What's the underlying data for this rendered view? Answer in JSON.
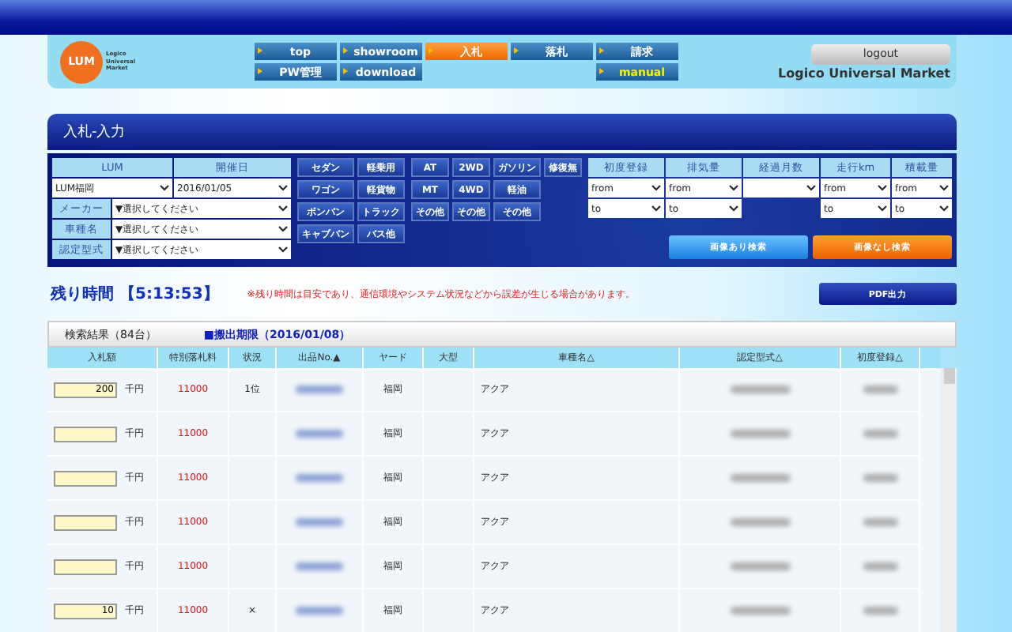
{
  "header": {
    "logo": {
      "mark": "LUM",
      "lines": [
        "Logico",
        "Universal",
        "Market"
      ]
    },
    "nav": [
      {
        "kind": "link",
        "label": "top",
        "selected": false,
        "highlighted": false
      },
      {
        "kind": "link",
        "label": "showroom",
        "selected": false,
        "highlighted": false
      },
      {
        "kind": "link",
        "label": "入札",
        "selected": true,
        "highlighted": false
      },
      {
        "kind": "link",
        "label": "落札",
        "selected": false,
        "highlighted": false
      },
      {
        "kind": "link",
        "label": "請求",
        "selected": false,
        "highlighted": false
      },
      {
        "kind": "link",
        "label": "PW管理",
        "selected": false,
        "highlighted": false
      },
      {
        "kind": "link",
        "label": "download",
        "selected": false,
        "highlighted": false
      },
      {
        "kind": "spacer"
      },
      {
        "kind": "spacer"
      },
      {
        "kind": "link",
        "label": "manual",
        "selected": false,
        "highlighted": true
      }
    ],
    "logout": "logout",
    "site_name": "Logico Universal Market"
  },
  "title": "入札-入力",
  "search": {
    "head": [
      "LUM",
      "開催日"
    ],
    "head_values": [
      "LUM福岡",
      "2016/01/05"
    ],
    "fields": [
      {
        "label": "メーカー",
        "value": "▼選択してください"
      },
      {
        "label": "車種名",
        "value": "▼選択してください"
      },
      {
        "label": "認定型式",
        "value": "▼選択してください"
      }
    ],
    "body_buttons": [
      [
        "セダン",
        "軽乗用"
      ],
      [
        "ワゴン",
        "軽貨物"
      ],
      [
        "ボンバン",
        "トラック"
      ],
      [
        "キャブバン",
        "バス他"
      ]
    ],
    "spec_buttons": [
      [
        "AT",
        "2WD",
        "ガソリン",
        "修復無"
      ],
      [
        "MT",
        "4WD",
        "軽油"
      ],
      [
        "その他",
        "その他",
        "その他"
      ]
    ],
    "ranges": [
      {
        "kind": "range",
        "label": "初度登録",
        "from": "from",
        "to": "to"
      },
      {
        "kind": "range",
        "label": "排気量",
        "from": "from",
        "to": "to"
      },
      {
        "kind": "single",
        "label": "経過月数"
      },
      {
        "kind": "range",
        "label": "走行km",
        "from": "from",
        "to": "to"
      },
      {
        "kind": "range",
        "label": "積載量",
        "from": "from",
        "to": "to"
      }
    ],
    "actions": [
      {
        "kind": "blue",
        "label": "画像あり検索"
      },
      {
        "kind": "orange",
        "label": "画像なし検索"
      }
    ]
  },
  "timer": {
    "label": "残り時間",
    "value": "【5:13:53】",
    "notice": "※残り時間は目安であり、通信環境やシステム状況などから誤差が生じる場合があります。",
    "pdf": "PDF出力"
  },
  "results": {
    "title": "検索結果（84台）",
    "deadline": "■搬出期限（2016/01/08）",
    "columns": [
      "入札額",
      "特別落札料",
      "状況",
      "出品No.▲",
      "ヤード",
      "大型",
      "車種名△",
      "認定型式△",
      "初度登録△"
    ],
    "rows": [
      {
        "bid": "200",
        "unit": "千円",
        "fee": "11000",
        "status": "1位",
        "yard": "福岡",
        "model": "アクア"
      },
      {
        "unit": "千円",
        "fee": "11000",
        "yard": "福岡",
        "model": "アクア"
      },
      {
        "unit": "千円",
        "fee": "11000",
        "yard": "福岡",
        "model": "アクア"
      },
      {
        "unit": "千円",
        "fee": "11000",
        "yard": "福岡",
        "model": "アクア"
      },
      {
        "unit": "千円",
        "fee": "11000",
        "yard": "福岡",
        "model": "アクア"
      },
      {
        "bid": "10",
        "unit": "千円",
        "fee": "11000",
        "status": "×",
        "yard": "福岡",
        "model": "アクア"
      }
    ]
  }
}
